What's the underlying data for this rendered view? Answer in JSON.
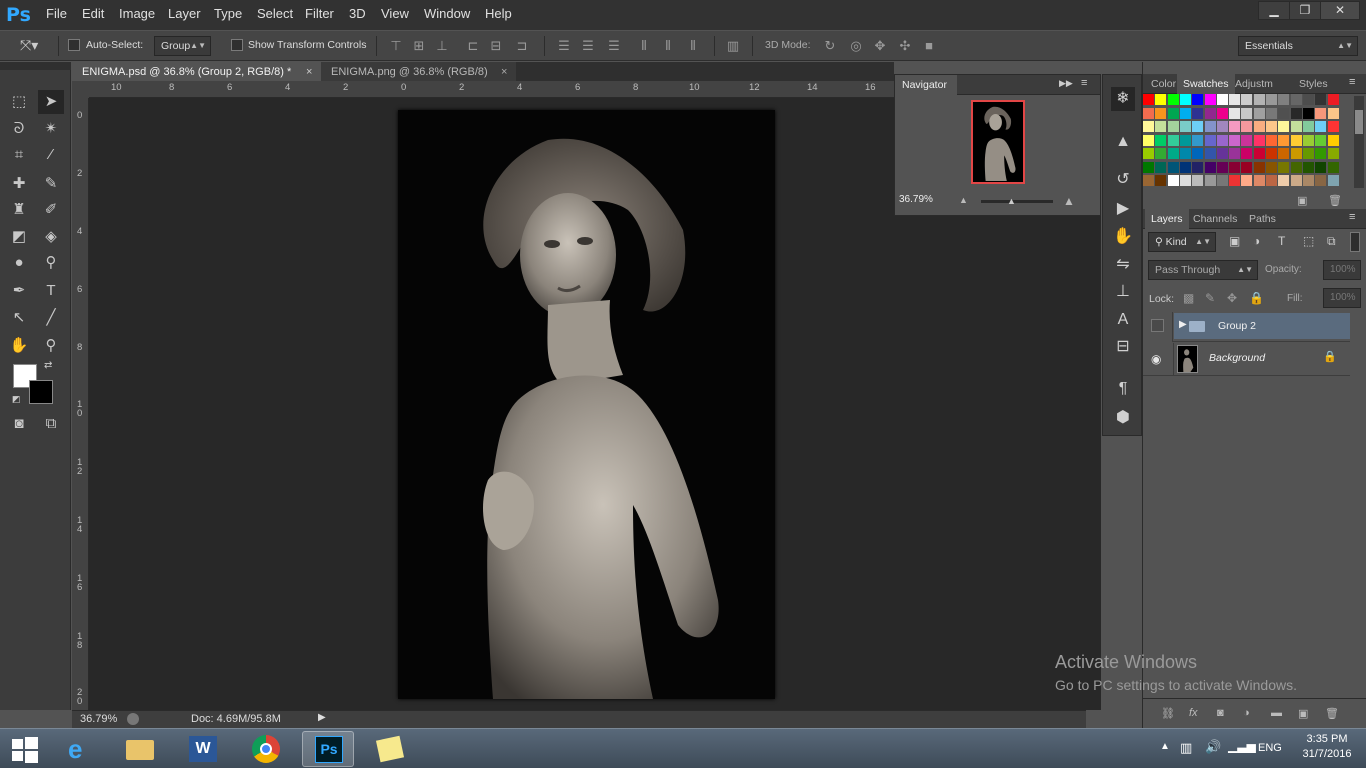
{
  "app": {
    "logo": "Ps"
  },
  "menu": [
    "File",
    "Edit",
    "Image",
    "Layer",
    "Type",
    "Select",
    "Filter",
    "3D",
    "View",
    "Window",
    "Help"
  ],
  "window_controls": {
    "minimize": "▁",
    "maximize": "❐",
    "close": "✕"
  },
  "options": {
    "auto_select_label": "Auto-Select:",
    "auto_select_value": "Group",
    "show_transform_label": "Show Transform Controls",
    "mode_3d_label": "3D Mode:",
    "workspace": "Essentials"
  },
  "tabs": [
    {
      "label": "ENIGMA.psd @ 36.8% (Group 2, RGB/8) *",
      "close": "×",
      "active": true
    },
    {
      "label": "ENIGMA.png @ 36.8% (RGB/8)",
      "close": "×",
      "active": false
    }
  ],
  "ruler_h": [
    "10",
    "8",
    "6",
    "4",
    "2",
    "0",
    "2",
    "4",
    "6",
    "8",
    "10",
    "12",
    "14",
    "16"
  ],
  "ruler_v": [
    "0",
    "2",
    "4",
    "6",
    "8",
    "1 0",
    "1 2",
    "1 4",
    "1 6",
    "1 8",
    "2 0"
  ],
  "status": {
    "zoom": "36.79%",
    "doc": "Doc: 4.69M/95.8M"
  },
  "navigator": {
    "title": "Navigator",
    "zoom": "36.79%"
  },
  "swatch_tabs": [
    "Color",
    "Swatches",
    "Adjustm",
    "Styles"
  ],
  "swatch_active": "Swatches",
  "swatch_colors": [
    [
      "#ff0000",
      "#ffff00",
      "#00ff00",
      "#00ffff",
      "#0000ff",
      "#ff00ff",
      "#ffffff",
      "#e6e6e6",
      "#cccccc",
      "#b3b3b3",
      "#999999",
      "#808080",
      "#666666",
      "#4d4d4d",
      "#333333",
      "#ed1c24"
    ],
    [
      "#f26c4f",
      "#f7941d",
      "#00a651",
      "#00aeef",
      "#2e3192",
      "#92278f",
      "#ec008c",
      "#e6e6e6",
      "#c8c8c8",
      "#a0a0a0",
      "#787878",
      "#505050",
      "#282828",
      "#000000",
      "#f7977a",
      "#fdc689"
    ],
    [
      "#fff799",
      "#c4df9b",
      "#a3d39c",
      "#7accc8",
      "#6dcff6",
      "#8393ca",
      "#a187be",
      "#f49ac1",
      "#f6989d",
      "#f9ad81",
      "#fdc68a",
      "#fff79a",
      "#c4df9b",
      "#82ca9c",
      "#6ecff6",
      "#ff3333"
    ],
    [
      "#ffff66",
      "#00cc66",
      "#33cc99",
      "#009999",
      "#3399cc",
      "#6666cc",
      "#9966cc",
      "#cc66cc",
      "#cc3399",
      "#ff3366",
      "#ff6633",
      "#ff9933",
      "#ffcc33",
      "#99cc33",
      "#66cc33",
      "#ffcc00"
    ],
    [
      "#99cc00",
      "#33aa33",
      "#00aa88",
      "#0088aa",
      "#0066bb",
      "#3355aa",
      "#663399",
      "#993399",
      "#cc0066",
      "#cc0033",
      "#cc3300",
      "#cc6600",
      "#cc9900",
      "#669900",
      "#339900",
      "#88aa00"
    ],
    [
      "#007700",
      "#006655",
      "#005577",
      "#003377",
      "#222266",
      "#440066",
      "#660055",
      "#880033",
      "#990022",
      "#883300",
      "#885500",
      "#777700",
      "#446600",
      "#225500",
      "#114400",
      "#336600"
    ],
    [
      "#996633",
      "#663300",
      "#ffffff",
      "#dddddd",
      "#bbbbbb",
      "#999999",
      "#777777",
      "#ee3333",
      "#ffaa88",
      "#dd8866",
      "#bb6644",
      "#eeccaa",
      "#ccaa88",
      "#aa8866",
      "#886644",
      "#7fa4b0"
    ]
  ],
  "layers": {
    "tabs": [
      "Layers",
      "Channels",
      "Paths"
    ],
    "filter": "Kind",
    "blend": "Pass Through",
    "opacity_label": "Opacity:",
    "opacity": "100%",
    "lock_label": "Lock:",
    "fill_label": "Fill:",
    "fill": "100%",
    "items": [
      {
        "name": "Group 2",
        "type": "group",
        "visible": false,
        "selected": true
      },
      {
        "name": "Background",
        "type": "pixel",
        "visible": true,
        "selected": false,
        "locked": true
      }
    ]
  },
  "watermark": {
    "title": "Activate Windows",
    "subtitle": "Go to PC settings to activate Windows."
  },
  "taskbar": {
    "apps": [
      "start",
      "ie",
      "explorer",
      "word",
      "chrome",
      "photoshop",
      "sticky-notes"
    ],
    "lang": "ENG",
    "time": "3:35 PM",
    "date": "31/7/2016"
  },
  "colors": {
    "accent": "#31a8ff",
    "selected_layer": "#5a6b7e"
  }
}
